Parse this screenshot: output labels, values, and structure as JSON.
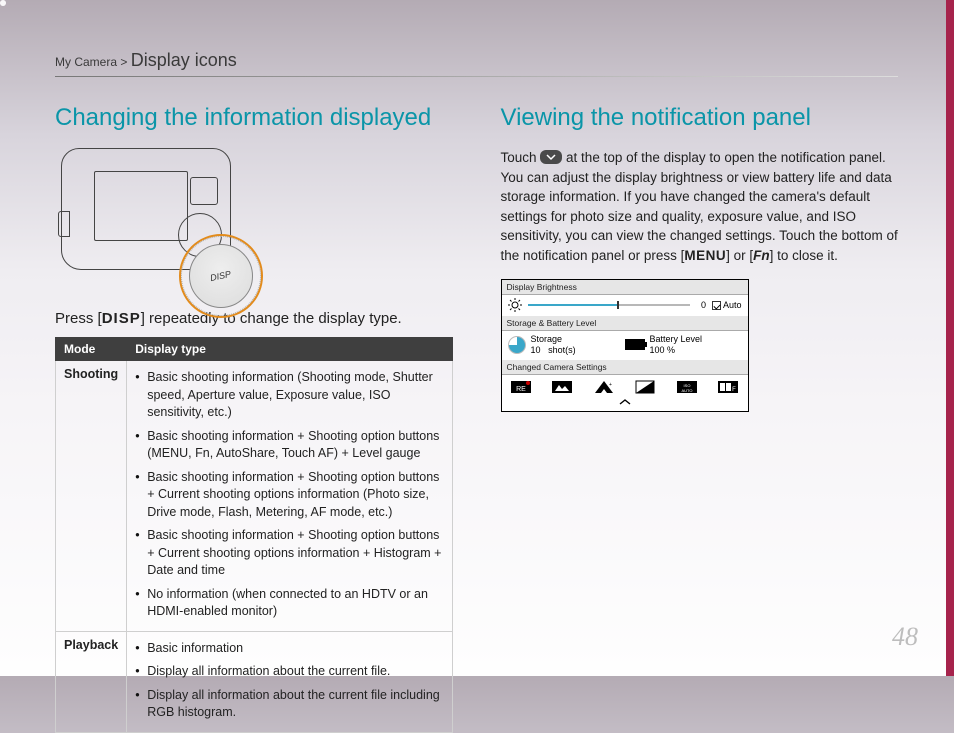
{
  "breadcrumb": {
    "prefix": "My Camera >",
    "page": "Display icons"
  },
  "left": {
    "heading": "Changing the information displayed",
    "dial_label": "DISP",
    "lead_pre": "Press [",
    "lead_btn": "DISP",
    "lead_post": "] repeatedly to change the display type.",
    "table": {
      "col_mode": "Mode",
      "col_type": "Display type",
      "rows": [
        {
          "mode": "Shooting",
          "items": [
            "Basic shooting information (Shooting mode, Shutter speed, Aperture value, Exposure value, ISO sensitivity, etc.)",
            "Basic shooting information + Shooting option buttons (MENU, Fn, AutoShare, Touch AF) + Level gauge",
            "Basic shooting information + Shooting option buttons + Current shooting options information (Photo size, Drive mode, Flash, Metering, AF mode, etc.)",
            "Basic shooting information + Shooting option buttons + Current shooting options information + Histogram + Date and time",
            "No information (when connected to an HDTV or an HDMI-enabled monitor)"
          ]
        },
        {
          "mode": "Playback",
          "items": [
            "Basic information",
            "Display all information about the current file.",
            "Display all information about the current file including RGB histogram."
          ]
        }
      ]
    }
  },
  "right": {
    "heading": "Viewing the notification panel",
    "body_a": "Touch ",
    "body_b": " at the top of the display to open the notification panel. You can adjust the display brightness or view battery life and data storage information. If you have changed the camera's default settings for photo size and quality, exposure value, and ISO sensitivity, you can view the changed settings. Touch the bottom of the notification panel or press [",
    "menu_label": "MENU",
    "body_c": "] or [",
    "fn_label": "Fn",
    "body_d": "] to close it.",
    "panel": {
      "brightness_label": "Display Brightness",
      "brightness_value": "0",
      "auto_label": "Auto",
      "storage_battery_label": "Storage & Battery Level",
      "storage_label": "Storage",
      "storage_value": "10",
      "storage_unit": "shot(s)",
      "battery_label": "Battery Level",
      "battery_value": "100 %",
      "changed_label": "Changed Camera Settings"
    }
  },
  "page_number": "48"
}
